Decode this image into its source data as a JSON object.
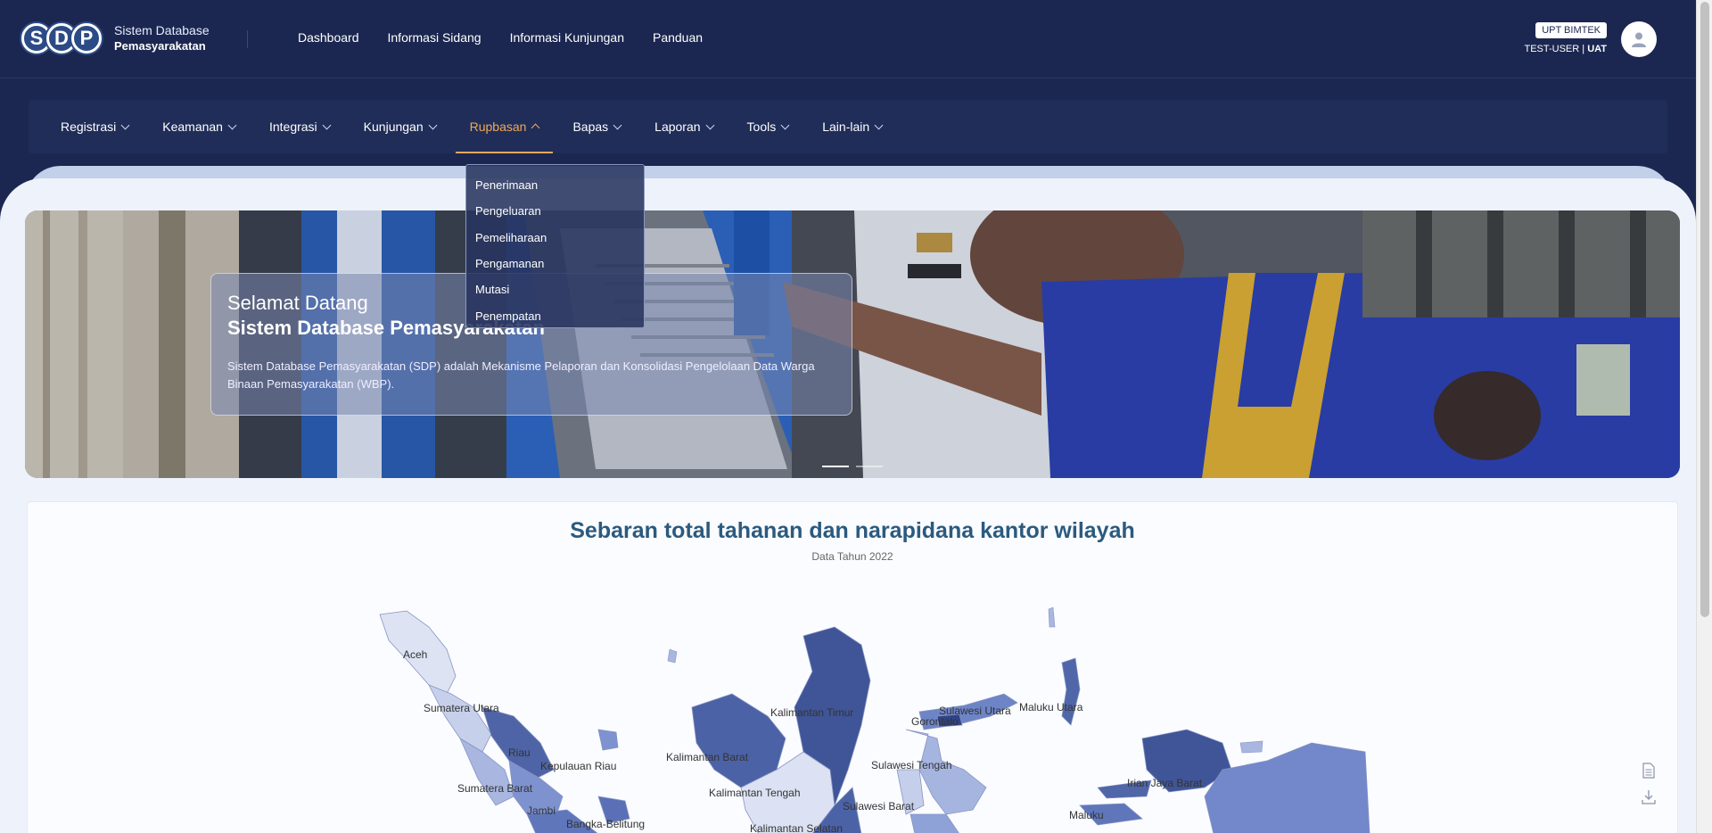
{
  "header": {
    "logo_letters": [
      "S",
      "D",
      "P"
    ],
    "app_name_line1": "Sistem Database",
    "app_name_line2": "Pemasyarakatan",
    "nav": [
      "Dashboard",
      "Informasi Sidang",
      "Informasi Kunjungan",
      "Panduan"
    ],
    "unit_badge": "UPT BIMTEK",
    "username": "TEST-USER",
    "separator": "|",
    "environment": "UAT"
  },
  "menu": {
    "items": [
      "Registrasi",
      "Keamanan",
      "Integrasi",
      "Kunjungan",
      "Rupbasan",
      "Bapas",
      "Laporan",
      "Tools",
      "Lain-lain"
    ],
    "active": "Rupbasan",
    "dropdown": [
      "Penerimaan",
      "Pengeluaran",
      "Pemeliharaan",
      "Pengamanan",
      "Mutasi",
      "Penempatan"
    ]
  },
  "hero": {
    "title_line1": "Selamat Datang",
    "title_line2": "Sistem Database Pemasyarakatan",
    "description": "Sistem Database Pemasyarakatan (SDP) adalah Mekanisme Pelaporan dan Konsolidasi Pengelolaan Data Warga Binaan Pemasyarakatan (WBP)."
  },
  "map": {
    "title": "Sebaran total tahanan dan narapidana kantor wilayah",
    "subtitle": "Data Tahun 2022",
    "regions": [
      "Aceh",
      "Sumatera Utara",
      "Riau",
      "Kepulauan Riau",
      "Sumatera Barat",
      "Jambi",
      "Bangka-Belitung",
      "Kalimantan Timur",
      "Kalimantan Barat",
      "Kalimantan Tengah",
      "Kalimantan Selatan",
      "Gorontalo",
      "Sulawesi Utara",
      "Maluku Utara",
      "Sulawesi Tengah",
      "Sulawesi Barat",
      "Maluku",
      "Irian Jaya Barat"
    ]
  },
  "colors": {
    "nav_bg": "#1b2750",
    "accent": "#f2a85a",
    "map_title": "#2b5a7e"
  },
  "icons": {
    "avatar": "user-icon",
    "side": [
      "document-icon",
      "download-icon"
    ]
  }
}
